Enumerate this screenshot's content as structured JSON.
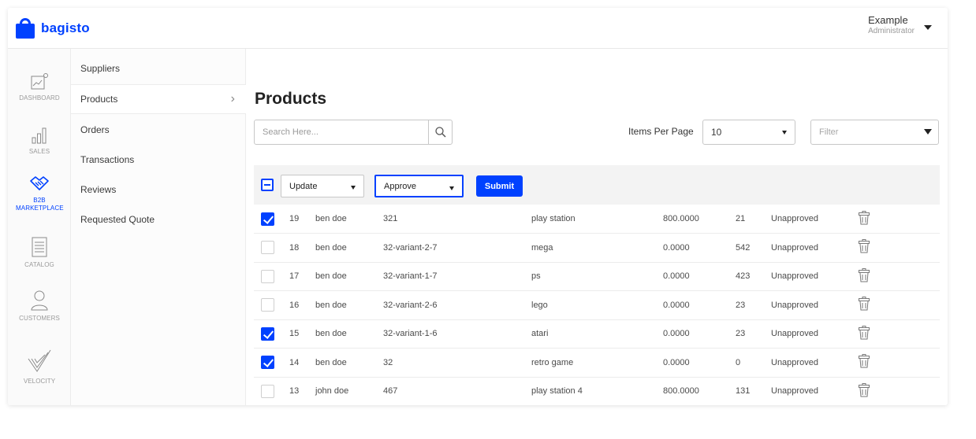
{
  "brand": {
    "name": "bagisto",
    "color": "#0041ff"
  },
  "account": {
    "name": "Example",
    "role": "Administrator"
  },
  "rail": [
    {
      "label": "DASHBOARD",
      "icon": "dashboard-icon"
    },
    {
      "label": "SALES",
      "icon": "sales-icon"
    },
    {
      "label": "B2B MARKETPLACE",
      "icon": "marketplace-icon",
      "active": true
    },
    {
      "label": "CATALOG",
      "icon": "catalog-icon"
    },
    {
      "label": "CUSTOMERS",
      "icon": "customers-icon"
    },
    {
      "label": "VELOCITY",
      "icon": "velocity-icon"
    }
  ],
  "submenu": [
    {
      "label": "Suppliers"
    },
    {
      "label": "Products",
      "active": true
    },
    {
      "label": "Orders"
    },
    {
      "label": "Transactions"
    },
    {
      "label": "Reviews"
    },
    {
      "label": "Requested Quote"
    }
  ],
  "page": {
    "title": "Products"
  },
  "search": {
    "placeholder": "Search Here..."
  },
  "items_per_page": {
    "label": "Items Per Page",
    "value": "10"
  },
  "filter": {
    "placeholder": "Filter"
  },
  "mass_action": {
    "action": "Update",
    "status": "Approve",
    "submit": "Submit"
  },
  "rows": [
    {
      "id": "19",
      "seller": "ben doe",
      "sku": "321",
      "name": "play station",
      "price": "800.0000",
      "qty": "21",
      "status": "Unapproved",
      "checked": true
    },
    {
      "id": "18",
      "seller": "ben doe",
      "sku": "32-variant-2-7",
      "name": "mega",
      "price": "0.0000",
      "qty": "542",
      "status": "Unapproved",
      "checked": false
    },
    {
      "id": "17",
      "seller": "ben doe",
      "sku": "32-variant-1-7",
      "name": "ps",
      "price": "0.0000",
      "qty": "423",
      "status": "Unapproved",
      "checked": false
    },
    {
      "id": "16",
      "seller": "ben doe",
      "sku": "32-variant-2-6",
      "name": "lego",
      "price": "0.0000",
      "qty": "23",
      "status": "Unapproved",
      "checked": false
    },
    {
      "id": "15",
      "seller": "ben doe",
      "sku": "32-variant-1-6",
      "name": "atari",
      "price": "0.0000",
      "qty": "23",
      "status": "Unapproved",
      "checked": true
    },
    {
      "id": "14",
      "seller": "ben doe",
      "sku": "32",
      "name": "retro game",
      "price": "0.0000",
      "qty": "0",
      "status": "Unapproved",
      "checked": true
    },
    {
      "id": "13",
      "seller": "john doe",
      "sku": "467",
      "name": "play station 4",
      "price": "800.0000",
      "qty": "131",
      "status": "Unapproved",
      "checked": false
    }
  ]
}
